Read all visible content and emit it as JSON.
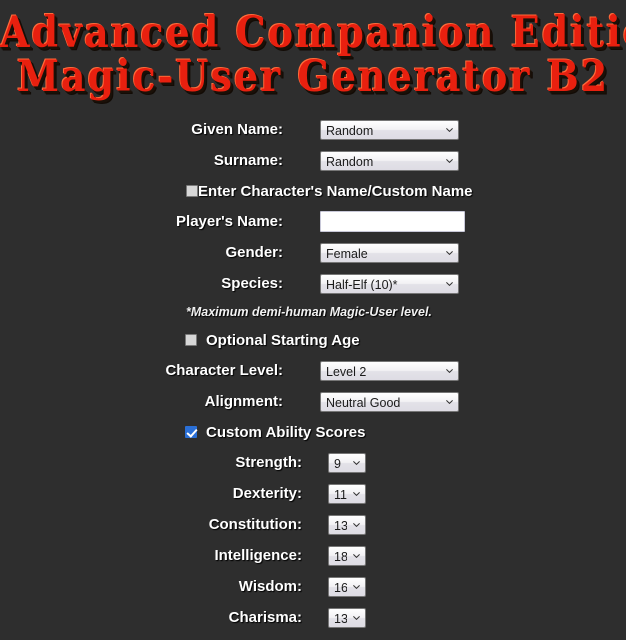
{
  "header": {
    "title_line1": "Advanced Companion Edition",
    "title_line2": "Magic-User Generator B2",
    "title_color": "#e8200f",
    "background_color": "#2e2e2e"
  },
  "form": {
    "given_name": {
      "label": "Given Name:",
      "value": "Random"
    },
    "surname": {
      "label": "Surname:",
      "value": "Random"
    },
    "custom_name_checkbox": {
      "label": "Enter Character's Name/Custom Name",
      "checked": false
    },
    "players_name": {
      "label": "Player's Name:",
      "value": "",
      "placeholder": ""
    },
    "gender": {
      "label": "Gender:",
      "value": "Female"
    },
    "species": {
      "label": "Species:",
      "value": "Half-Elf (10)*"
    },
    "species_footnote": "*Maximum demi-human Magic-User level.",
    "optional_age_checkbox": {
      "label": "Optional Starting Age",
      "checked": false
    },
    "character_level": {
      "label": "Character Level:",
      "value": "Level 2"
    },
    "alignment": {
      "label": "Alignment:",
      "value": "Neutral Good"
    },
    "custom_ability_checkbox": {
      "label": "Custom Ability Scores",
      "checked": true,
      "accent_color": "#2a6fd6"
    }
  },
  "abilities": [
    {
      "label": "Strength:",
      "value": "9"
    },
    {
      "label": "Dexterity:",
      "value": "11"
    },
    {
      "label": "Constitution:",
      "value": "13"
    },
    {
      "label": "Intelligence:",
      "value": "18"
    },
    {
      "label": "Wisdom:",
      "value": "16"
    },
    {
      "label": "Charisma:",
      "value": "13"
    }
  ],
  "icons": {
    "chevron_down": "chevron-down-icon",
    "checkmark": "check-icon"
  }
}
